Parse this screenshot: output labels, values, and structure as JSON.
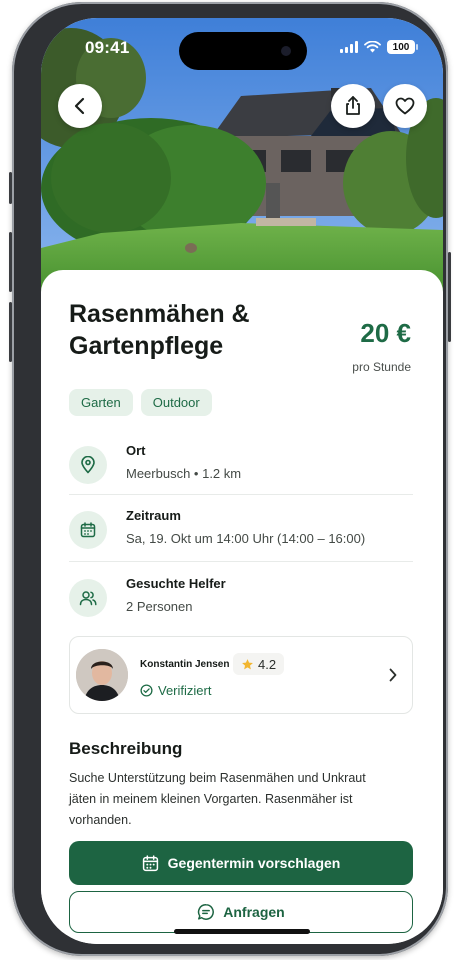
{
  "status_bar": {
    "time": "09:41",
    "battery": "100"
  },
  "nav": {
    "back_icon": "chevron-left-icon",
    "share_icon": "share-icon",
    "favorite_icon": "heart-icon"
  },
  "listing": {
    "title": "Rasenmähen & Gartenpflege",
    "price": "20 €",
    "price_unit": "pro Stunde",
    "tags": [
      "Garten",
      "Outdoor"
    ]
  },
  "details": [
    {
      "icon": "map-pin-icon",
      "label": "Ort",
      "value": "Meerbusch • 1.2 km"
    },
    {
      "icon": "calendar-icon",
      "label": "Zeitraum",
      "value": "Sa, 19. Okt um 14:00 Uhr (14:00 – 16:00)"
    },
    {
      "icon": "users-icon",
      "label": "Gesuchte Helfer",
      "value": "2 Personen"
    }
  ],
  "host": {
    "name": "Konstantin Jensen",
    "rating": "4.2",
    "verified_label": "Verifiziert"
  },
  "description": {
    "heading": "Beschreibung",
    "text": "Suche Unterstützung beim Rasenmähen und Unkraut jäten in meinem kleinen Vorgarten. Rasenmäher ist vorhanden."
  },
  "actions": {
    "primary_label": "Gegentermin vorschlagen",
    "secondary_label": "Anfragen"
  },
  "colors": {
    "brand": "#1d6442",
    "tag_bg": "#e6f1e9",
    "star": "#f2b630"
  }
}
